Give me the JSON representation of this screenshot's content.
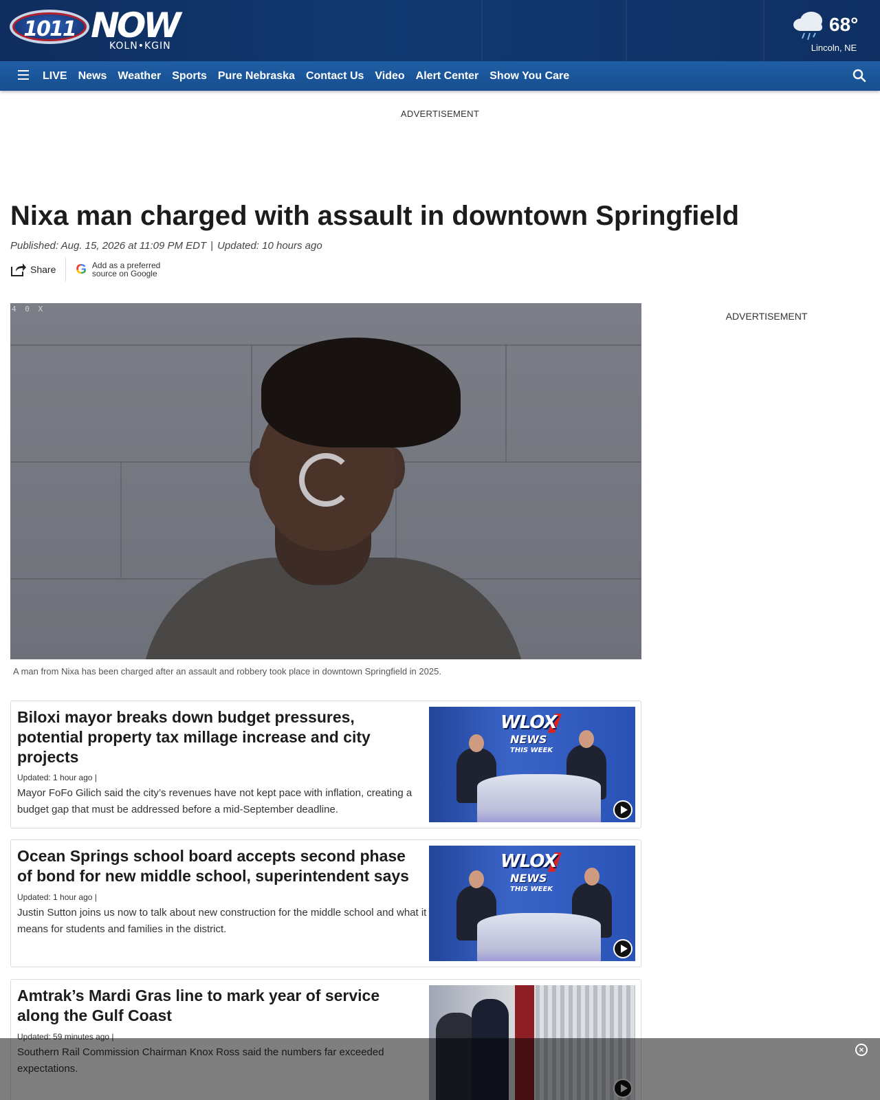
{
  "brand": {
    "logo_number": "1011",
    "logo_word": "NOW",
    "logo_sub": "KOLN•KGIN"
  },
  "weather": {
    "icon": "cloud-rain-icon",
    "temperature": "68°",
    "location": "Lincoln, NE"
  },
  "nav": {
    "menu_icon": "hamburger-menu-icon",
    "items": [
      "LIVE",
      "News",
      "Weather",
      "Sports",
      "Pure Nebraska",
      "Contact Us",
      "Video",
      "Alert Center",
      "Show You Care"
    ],
    "search_icon": "search-icon"
  },
  "ads": {
    "top_label": "ADVERTISEMENT",
    "right_label": "ADVERTISEMENT"
  },
  "article": {
    "headline": "Nixa man charged with assault in downtown Springfield",
    "published": "Published: Aug. 15, 2026 at 11:09 PM EDT",
    "separator": "|",
    "updated": "Updated: 10 hours ago",
    "share_label": "Share",
    "google_line1": "Add as a preferred",
    "google_line2": "source on Google",
    "google_letter": "G",
    "hero_overlay_text": "4 0 X",
    "caption": "A man from Nixa has been charged after an assault and robbery took place in downtown Springfield in 2025."
  },
  "related": [
    {
      "title": "Biloxi mayor breaks down budget pressures, potential property tax millage increase and city projects",
      "meta": "Updated: 1 hour ago  |",
      "summary": "Mayor FoFo Gilich said the city’s revenues have not kept pace with inflation, creating a budget gap that must be addressed before a mid-September deadline.",
      "thumb_brand": "WLOX",
      "thumb_brand2": "NEWS",
      "thumb_brand3": "THIS WEEK"
    },
    {
      "title": "Ocean Springs school board accepts second phase of bond for new middle school, superintendent says",
      "meta": "Updated: 1 hour ago  |",
      "summary": "Justin Sutton joins us now to talk about new construction for the middle school and what it means for students and families in the district.",
      "thumb_brand": "WLOX",
      "thumb_brand2": "NEWS",
      "thumb_brand3": "THIS WEEK"
    },
    {
      "title": "Amtrak’s Mardi Gras line to mark year of service along the Gulf Coast",
      "meta": "Updated: 59 minutes ago  |",
      "summary": "Southern Rail Commission Chairman Knox Ross said the numbers far exceeded expectations."
    }
  ],
  "overlay": {
    "close_icon": "close-circle-icon",
    "close_glyph": "×"
  }
}
